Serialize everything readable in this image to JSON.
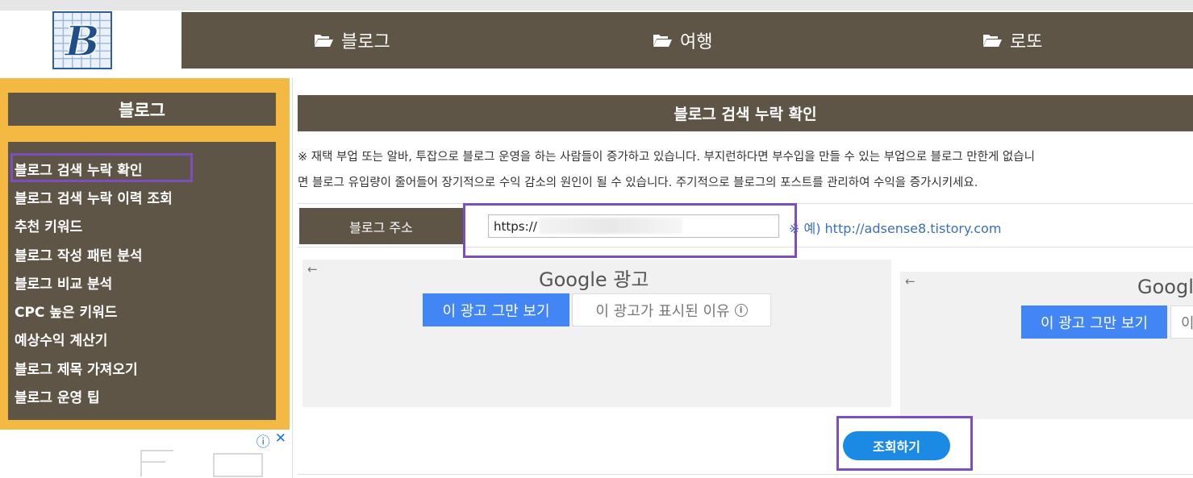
{
  "logo": {
    "letter": "B"
  },
  "nav": {
    "items": [
      {
        "label": "블로그"
      },
      {
        "label": "여행"
      },
      {
        "label": "로또"
      }
    ]
  },
  "sidebar": {
    "title": "블로그",
    "items": [
      {
        "label": "블로그 검색 누락 확인"
      },
      {
        "label": "블로그 검색 누락 이력 조회"
      },
      {
        "label": "추천 키워드"
      },
      {
        "label": "블로그 작성 패턴 분석"
      },
      {
        "label": "블로그 비교 분석"
      },
      {
        "label": "CPC 높은 키워드"
      },
      {
        "label": "예상수익 계산기"
      },
      {
        "label": "블로그 제목 가져오기"
      },
      {
        "label": "블로그 운영 팁"
      }
    ]
  },
  "left_ad": {
    "info": "ⓘ",
    "close": "✕"
  },
  "main": {
    "title": "블로그 검색 누락 확인",
    "desc_line1": "※ 재택 부업 또는 알바, 투잡으로 블로그 운영을 하는 사람들이 증가하고 있습니다. 부지런하다면 부수입을 만들 수 있는 부업으로 블로그 만한게 없습니",
    "desc_line2": "면 블로그 유입량이 줄어들어 장기적으로 수익 감소의 원인이 될 수 있습니다. 주기적으로 블로그의 포스트를 관리하여 수익을 증가시키세요.",
    "address": {
      "label": "블로그 주소",
      "value": "https://",
      "example": "※ 예) http://adsense8.tistory.com"
    },
    "submit_label": "조회하기"
  },
  "ads": {
    "back_arrow": "←",
    "google_label": "Google 광고",
    "google_label_short": "Googl",
    "stop_label": "이 광고 그만 보기",
    "why_label": "이 광고가 표시된 이유",
    "why_short": "이",
    "info_glyph": "i"
  },
  "colors": {
    "header_brown": "#5e5547",
    "sidebar_yellow": "#f4b942",
    "highlight_purple": "#7b4fc0",
    "button_blue": "#1a8ae5",
    "ad_blue": "#4285f4"
  }
}
